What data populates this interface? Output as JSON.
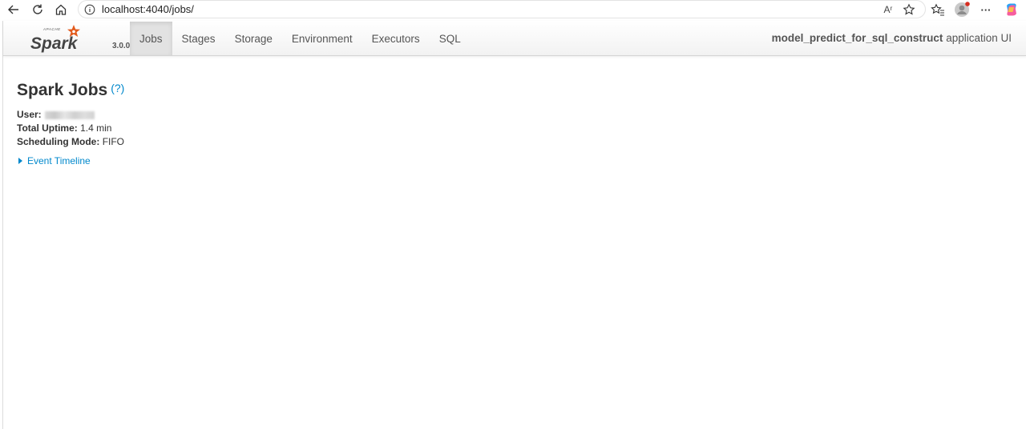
{
  "browser": {
    "url": "localhost:4040/jobs/",
    "icons": [
      "back-icon",
      "refresh-icon",
      "home-icon",
      "info-icon",
      "read-aloud-icon",
      "favorite-star-icon",
      "favorites-icon",
      "profile-icon",
      "more-icon",
      "copilot-icon"
    ],
    "read_aloud_label": "Aʳ",
    "more_label": "···"
  },
  "spark": {
    "brand_word": "Spark",
    "brand_super": "APACHE",
    "version": "3.0.0",
    "accent_color": "#e25a1c",
    "tabs": [
      {
        "label": "Jobs",
        "active": true
      },
      {
        "label": "Stages",
        "active": false
      },
      {
        "label": "Storage",
        "active": false
      },
      {
        "label": "Environment",
        "active": false
      },
      {
        "label": "Executors",
        "active": false
      },
      {
        "label": "SQL",
        "active": false
      }
    ],
    "app_name": "model_predict_for_sql_construct",
    "app_suffix": "application UI"
  },
  "page": {
    "title": "Spark Jobs",
    "help": "(?)",
    "user_label": "User:",
    "uptime_label": "Total Uptime:",
    "uptime_value": "1.4 min",
    "mode_label": "Scheduling Mode:",
    "mode_value": "FIFO",
    "timeline_label": "Event Timeline"
  }
}
